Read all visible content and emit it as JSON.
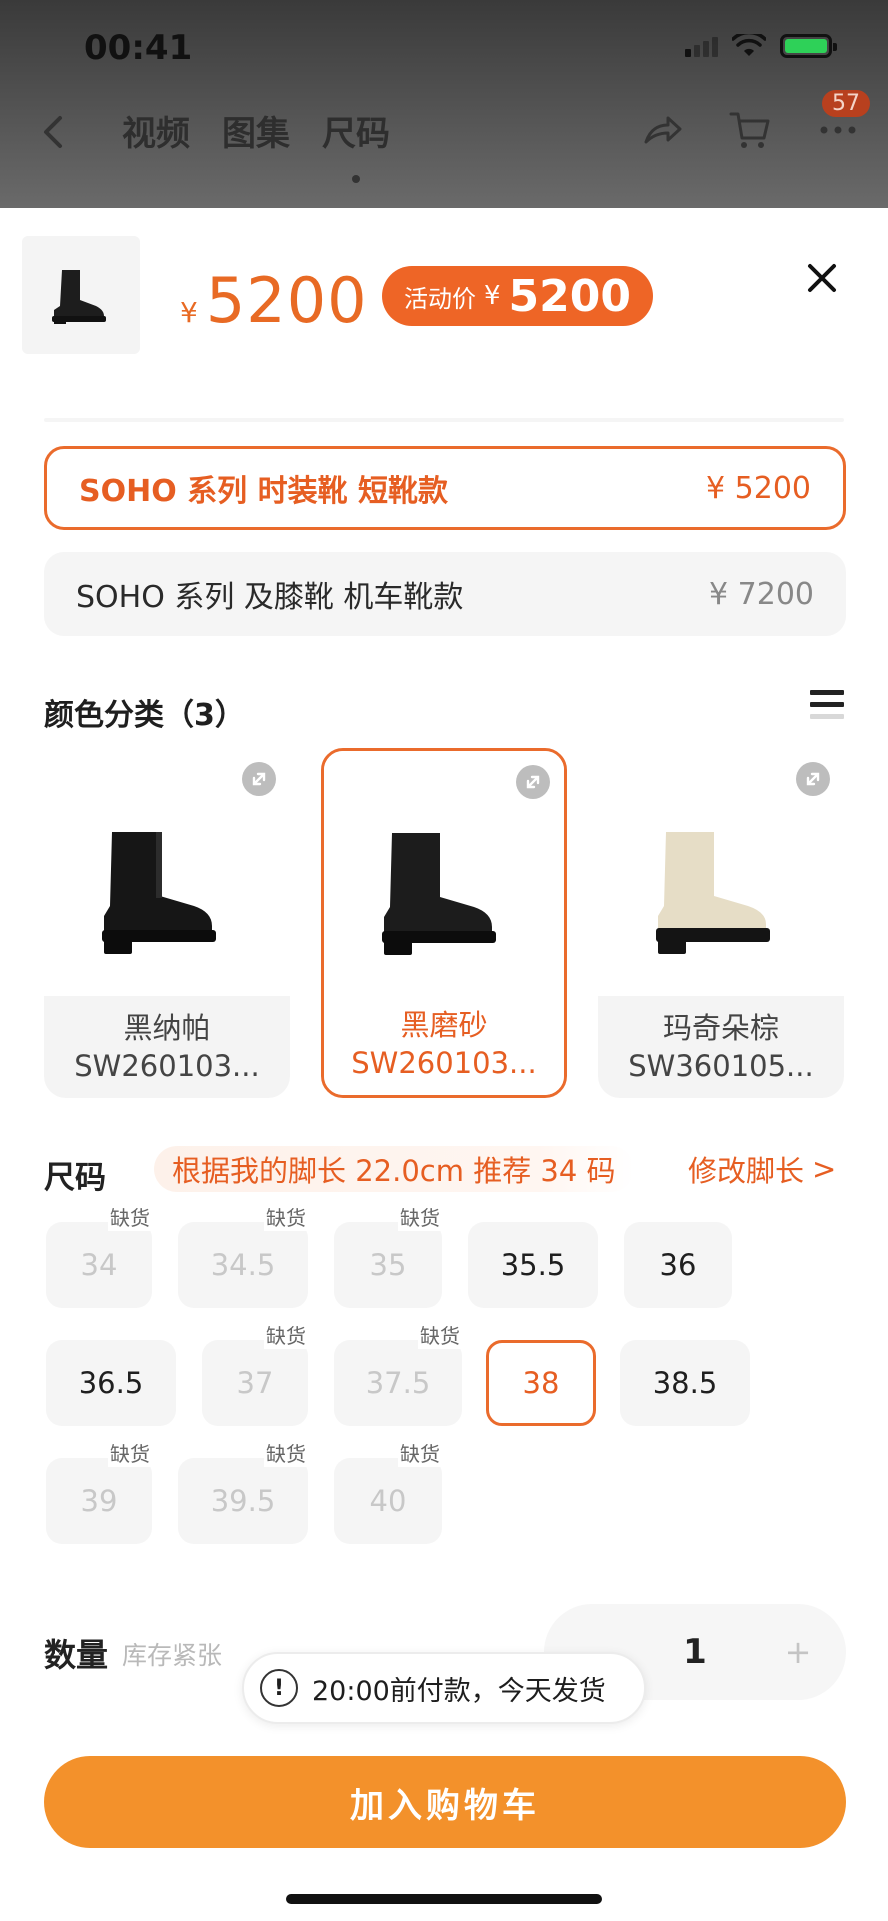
{
  "status": {
    "time": "00:41"
  },
  "nav": {
    "tabs": [
      {
        "label": "视频"
      },
      {
        "label": "图集"
      },
      {
        "label": "尺码"
      }
    ],
    "more_badge": "57"
  },
  "header": {
    "price_symbol": "¥",
    "price": "5200",
    "promo_label": "活动价",
    "promo_symbol": "¥",
    "promo_price": "5200"
  },
  "variants": [
    {
      "name": "SOHO 系列 时装靴  短靴款",
      "price": "¥ 5200",
      "selected": true
    },
    {
      "name": "SOHO 系列 及膝靴 机车靴款",
      "price": "¥ 7200",
      "selected": false
    }
  ],
  "color_section": {
    "title": "颜色分类（3）",
    "items": [
      {
        "name": "黑纳帕",
        "code": "SW260103...",
        "selected": false
      },
      {
        "name": "黑磨砂",
        "code": "SW260103...",
        "selected": true
      },
      {
        "name": "玛奇朵棕",
        "code": "SW360105...",
        "selected": false
      }
    ]
  },
  "size_section": {
    "title": "尺码",
    "tip": "根据我的脚长 22.0cm 推荐 34 码",
    "edit_label": "修改脚长",
    "edit_arrow": ">",
    "oos_label": "缺货",
    "sizes": [
      {
        "label": "34",
        "oos": true
      },
      {
        "label": "34.5",
        "oos": true
      },
      {
        "label": "35",
        "oos": true
      },
      {
        "label": "35.5",
        "oos": false
      },
      {
        "label": "36",
        "oos": false
      },
      {
        "label": "36.5",
        "oos": false
      },
      {
        "label": "37",
        "oos": true
      },
      {
        "label": "37.5",
        "oos": true
      },
      {
        "label": "38",
        "oos": false,
        "selected": true
      },
      {
        "label": "38.5",
        "oos": false
      },
      {
        "label": "39",
        "oos": true
      },
      {
        "label": "39.5",
        "oos": true
      },
      {
        "label": "40",
        "oos": true
      }
    ]
  },
  "quantity": {
    "label": "数量",
    "note": "库存紧张",
    "value": "1",
    "plus": "+"
  },
  "toast": {
    "icon": "!",
    "text": "20:00前付款，今天发货"
  },
  "cta": {
    "label": "加入购物车"
  },
  "colors": {
    "accent": "#ea6b2c",
    "cta": "#f3912b",
    "promo": "#ee6526"
  }
}
